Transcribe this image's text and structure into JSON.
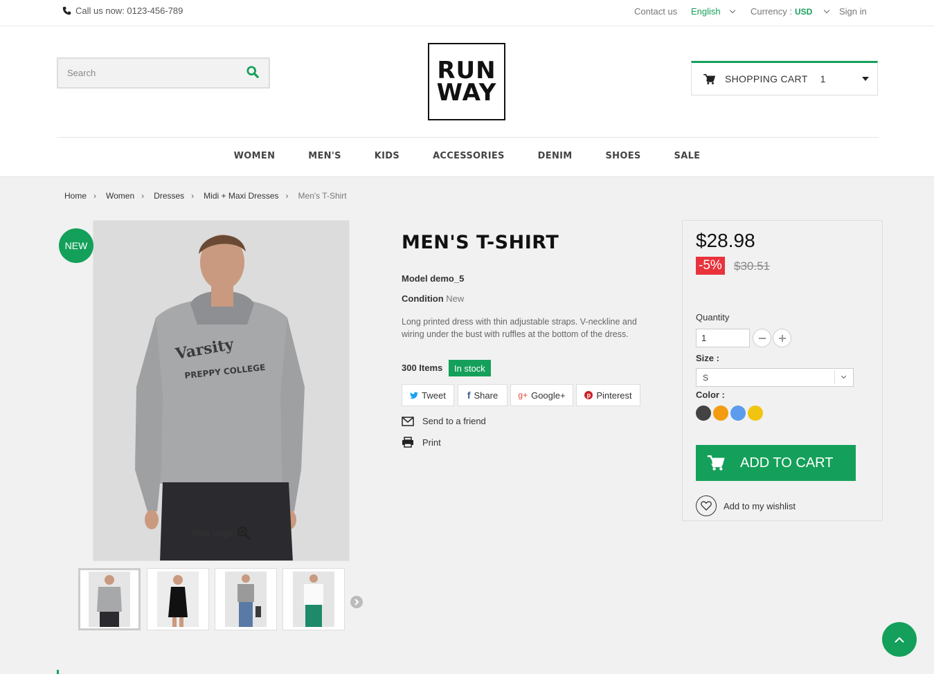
{
  "topbar": {
    "call_text": "Call us now: 0123-456-789",
    "contact": "Contact us",
    "language": "English",
    "currency_label": "Currency :",
    "currency_value": "USD",
    "signin": "Sign in"
  },
  "search": {
    "placeholder": "Search"
  },
  "logo": {
    "line1": "RUN",
    "line2": "WAY"
  },
  "cart": {
    "label": "SHOPPING CART",
    "count": "1"
  },
  "nav": [
    "WOMEN",
    "MEN'S",
    "KIDS",
    "ACCESSORIES",
    "DENIM",
    "SHOES",
    "SALE"
  ],
  "breadcrumb": [
    "Home",
    "Women",
    "Dresses",
    "Midi + Maxi Dresses",
    "Men's T-Shirt"
  ],
  "product": {
    "badge": "NEW",
    "view_large": "View large",
    "title": "MEN'S T-SHIRT",
    "model_label": "Model",
    "model_value": "demo_5",
    "condition_label": "Condition",
    "condition_value": "New",
    "description": "Long printed dress with thin adjustable straps. V-neckline and wiring under the bust with ruffles at the bottom of the dress.",
    "items": "300 Items",
    "stock": "In stock"
  },
  "share": [
    "Tweet",
    "Share",
    "Google+",
    "Pinterest"
  ],
  "links": {
    "send": "Send to a friend",
    "print": "Print"
  },
  "buy": {
    "price": "$28.98",
    "discount": "-5%",
    "old_price": "$30.51",
    "quantity_label": "Quantity",
    "quantity_value": "1",
    "size_label": "Size :",
    "size_value": "S",
    "color_label": "Color :",
    "colors": [
      "#434343",
      "#f39c11",
      "#5d9cec",
      "#f1c40f"
    ],
    "add_to_cart": "ADD TO CART",
    "wishlist": "Add to my wishlist"
  },
  "accent_color": "#14a05a"
}
